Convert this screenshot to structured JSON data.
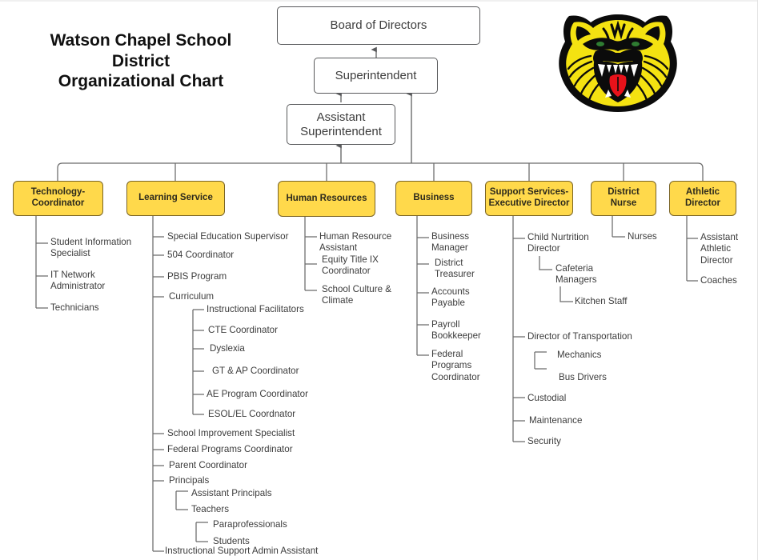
{
  "title": {
    "line1": "Watson Chapel School",
    "line2": "District",
    "line3": "Organizational Chart",
    "full": "Watson Chapel School District Organizational Chart"
  },
  "mascot": {
    "name": "tiger-head-mascot",
    "colors": {
      "fur": "#F4E211",
      "outline": "#0b0b0b",
      "teeth": "#ffffff",
      "tongue": "#E8121A",
      "eye": "#2f7d32"
    }
  },
  "colors": {
    "dept_fill": "#ffd94b",
    "dept_border": "#7a6425",
    "dept_text": "#2d2a1c",
    "box_border": "#58595b",
    "box_fill": "#ffffff",
    "line": "#6b6b6b",
    "text": "#3c3c3c",
    "title_text": "#101010"
  },
  "top_nodes": {
    "board": "Board of Directors",
    "superintendent": "Superintendent",
    "assistant_superintendent": "Assistant\nSuperintendent"
  },
  "departments": [
    {
      "id": "technology",
      "label": "Technology-\nCoordinator"
    },
    {
      "id": "learning",
      "label": "Learning Service"
    },
    {
      "id": "human-resources",
      "label": "Human Resources"
    },
    {
      "id": "business",
      "label": "Business"
    },
    {
      "id": "support-services",
      "label": "Support Services-\nExecutive Director"
    },
    {
      "id": "district-nurse",
      "label": "District\nNurse"
    },
    {
      "id": "athletic",
      "label": "Athletic\nDirector"
    }
  ],
  "branches": {
    "technology": [
      "Student Information\nSpecialist",
      "IT Network\nAdministrator",
      "Technicians"
    ],
    "learning": [
      "Special Education Supervisor",
      "504 Coordinator",
      "PBIS Program",
      "Curriculum",
      "School Improvement Specialist",
      "Federal Programs Coordinator",
      "Parent Coordinator",
      "Principals",
      "Instructional Support Admin  Assistant"
    ],
    "curriculum_children": [
      "Instructional Facilitators",
      "CTE Coordinator",
      "Dyslexia",
      "GT  & AP Coordinator",
      "AE Program Coordinator",
      "ESOL/EL Coordnator"
    ],
    "principals_children": [
      "Assistant Principals",
      "Teachers"
    ],
    "teachers_children": [
      "Paraprofessionals",
      "Students"
    ],
    "human_resources": [
      "Human Resource\nAssistant",
      "Equity Title IX\nCoordinator",
      "School Culture &\nClimate"
    ],
    "business": [
      "Business\nManager",
      "District\nTreasurer",
      "Accounts\nPayable",
      "Payroll\nBookkeeper",
      "Federal\nPrograms\nCoordinator"
    ],
    "support_services": [
      "Child Nurtrition\nDirector",
      "Director of Transportation",
      "Custodial",
      "Maintenance",
      "Security"
    ],
    "child_nutrition_children": [
      "Cafeteria\nManagers"
    ],
    "cafeteria_children": [
      "Kitchen Staff"
    ],
    "transportation_children": [
      "Mechanics",
      "Bus Drivers"
    ],
    "district_nurse": [
      "Nurses"
    ],
    "athletic": [
      "Assistant\nAthletic\nDirector",
      "Coaches"
    ]
  }
}
